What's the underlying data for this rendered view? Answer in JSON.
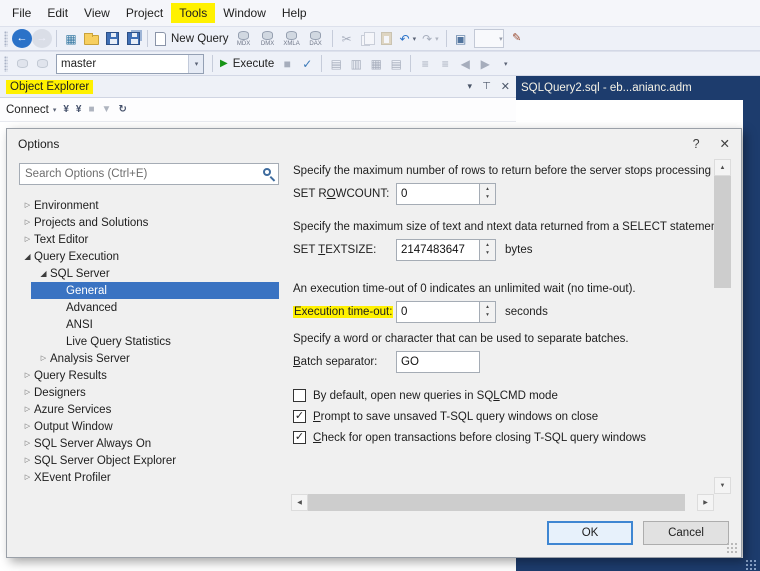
{
  "colors": {
    "annotation_highlight": "#fff100",
    "tree_selection": "#3a73c2",
    "editor_background": "#1d3c6d",
    "execute_green": "#169416",
    "default_button_border": "#3f86d2"
  },
  "glyphs": {
    "back": "←",
    "forward": "→",
    "caret": "▾",
    "undo": "↶",
    "redo": "↷",
    "cut": "✂",
    "check": "✓",
    "play": "▶",
    "stop": "■",
    "window_box": "▣",
    "pen": "✎",
    "activity": "▦",
    "doc_grid": "▤",
    "doc_grid2": "▥",
    "doc_grid3": "▦",
    "hamburger": "≡",
    "refresh": "↻",
    "funnel": "▼",
    "plug": "¥",
    "pin": "⊤",
    "close": "✕",
    "help": "?",
    "tree_collapsed": "▷",
    "tree_expanded": "◢",
    "spin_up": "▴",
    "spin_down": "▾",
    "scroll_up": "▲",
    "scroll_down": "▼",
    "scroll_left": "◀",
    "scroll_right": "▶"
  },
  "menubar": {
    "items": [
      "File",
      "Edit",
      "View",
      "Project",
      "Tools",
      "Window",
      "Help"
    ],
    "highlighted_item": "Tools"
  },
  "toolbar_standard": {
    "new_query": "New Query",
    "query_types": [
      "MDX",
      "DMX",
      "XMLA",
      "DAX"
    ]
  },
  "toolbar_sql": {
    "database": "master",
    "execute": "Execute"
  },
  "object_explorer": {
    "title": "Object Explorer",
    "connect": "Connect"
  },
  "editor": {
    "tab_label": "SQLQuery2.sql - eb...anianc.adm"
  },
  "dialog": {
    "title": "Options",
    "search_placeholder": "Search Options (Ctrl+E)",
    "tree": [
      {
        "label": "Environment",
        "level": 0,
        "state": "collapsed"
      },
      {
        "label": "Projects and Solutions",
        "level": 0,
        "state": "collapsed"
      },
      {
        "label": "Text Editor",
        "level": 0,
        "state": "collapsed"
      },
      {
        "label": "Query Execution",
        "level": 0,
        "state": "expanded"
      },
      {
        "label": "SQL Server",
        "level": 1,
        "state": "expanded"
      },
      {
        "label": "General",
        "level": 2,
        "state": "selected"
      },
      {
        "label": "Advanced",
        "level": 2,
        "state": "leaf"
      },
      {
        "label": "ANSI",
        "level": 2,
        "state": "leaf"
      },
      {
        "label": "Live Query Statistics",
        "level": 2,
        "state": "leaf"
      },
      {
        "label": "Analysis Server",
        "level": 1,
        "state": "collapsed"
      },
      {
        "label": "Query Results",
        "level": 0,
        "state": "collapsed"
      },
      {
        "label": "Designers",
        "level": 0,
        "state": "collapsed"
      },
      {
        "label": "Azure Services",
        "level": 0,
        "state": "collapsed"
      },
      {
        "label": "Output Window",
        "level": 0,
        "state": "collapsed"
      },
      {
        "label": "SQL Server Always On",
        "level": 0,
        "state": "collapsed"
      },
      {
        "label": "SQL Server Object Explorer",
        "level": 0,
        "state": "collapsed"
      },
      {
        "label": "XEvent Profiler",
        "level": 0,
        "state": "collapsed"
      }
    ],
    "settings": {
      "rowcount_desc": "Specify the maximum number of rows to return before the server stops processing y",
      "rowcount_label": "SET ROWCOUNT:",
      "rowcount_value": "0",
      "textsize_desc": "Specify the maximum size of text and ntext data returned from a SELECT statement.",
      "textsize_label": "SET TEXTSIZE:",
      "textsize_value": "2147483647",
      "textsize_unit": "bytes",
      "timeout_desc": "An execution time-out of 0 indicates an unlimited wait (no time-out).",
      "timeout_label": "Execution time-out:",
      "timeout_value": "0",
      "timeout_unit": "seconds",
      "batch_desc": "Specify a word or character that can be used to separate batches.",
      "batch_label": "Batch separator:",
      "batch_value": "GO",
      "checkboxes": [
        {
          "label": "By default, open new queries in SQLCMD mode",
          "checked": false
        },
        {
          "label": "Prompt to save unsaved T-SQL query windows on close",
          "checked": true
        },
        {
          "label": "Check for open transactions before closing T-SQL query windows",
          "checked": true
        }
      ]
    },
    "buttons": {
      "ok": "OK",
      "cancel": "Cancel"
    }
  }
}
